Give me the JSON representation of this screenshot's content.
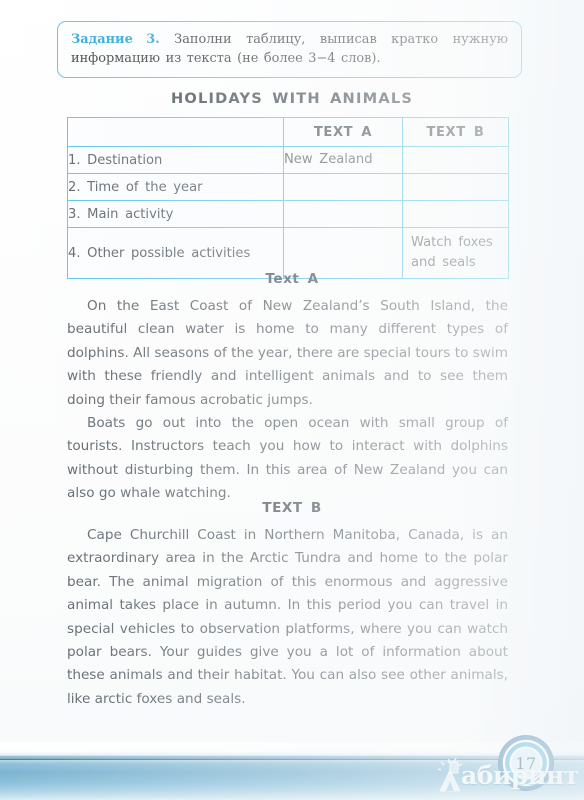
{
  "task": {
    "label": "Задание 3.",
    "text": "Заполни таблицу, выписав кратко нужную информацию из текста (не более 3−4 слов)."
  },
  "table": {
    "title": "HOLIDAYS WITH ANIMALS",
    "headers": [
      "",
      "TEXT A",
      "TEXT B"
    ],
    "rows": [
      {
        "label": "1.  Destination",
        "text_a": "New  Zealand",
        "text_b": ""
      },
      {
        "label": "2.  Time  of  the  year",
        "text_a": "",
        "text_b": ""
      },
      {
        "label": "3.  Main  activity",
        "text_a": "",
        "text_b": ""
      },
      {
        "label": "4.  Other  possible  activities",
        "text_a": "",
        "text_b": "Watch  foxes  and  seals"
      }
    ]
  },
  "text_a": {
    "heading": "Text  A",
    "paragraphs": [
      "On the East Coast of New Zealand’s South Island, the beautiful clean water is home to many different types of dolphins. All seasons of the year, there are special tours to swim with these friendly and intelligent animals and to see them doing their famous acrobatic jumps.",
      "Boats go out into the open ocean with small group of tourists. Instructors teach you how to interact with dolphins without disturbing them. In this area of New Zealand you can also go whale watching."
    ]
  },
  "text_b": {
    "heading": "TEXT  B",
    "paragraphs": [
      "Cape Churchill Coast in Northern Manitoba, Canada, is an extraordinary area in the Arctic Tundra and home to the polar bear. The animal migration of this enormous and aggressive animal takes place in autumn. In this period you can travel in special vehicles to observation platforms, where you can watch polar bears. Your guides give you a lot of information about these animals and their habitat. You can also see other animals, like arctic foxes and seals."
    ]
  },
  "footer": {
    "page_number": "17",
    "watermark_text": "абиринт"
  },
  "colors": {
    "accent_cyan": "#5cc3e8",
    "label_blue": "#2ba6d6",
    "body_text": "#5a636a",
    "heading_text": "#4a5258",
    "band_blue": "#7cb4d2"
  }
}
